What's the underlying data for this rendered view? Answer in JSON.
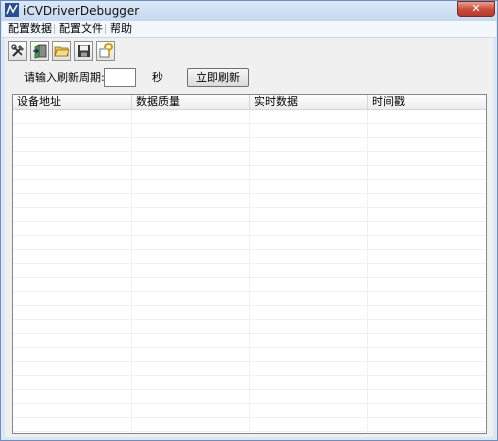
{
  "window": {
    "title": "iCVDriverDebugger",
    "close_symbol": "✕"
  },
  "menu": [
    {
      "label": "配置数据"
    },
    {
      "label": "配置文件"
    },
    {
      "label": "帮助"
    }
  ],
  "toolbar": {
    "buttons": [
      {
        "icon": "tools-icon"
      },
      {
        "icon": "open-door-icon"
      },
      {
        "icon": "folder-icon"
      },
      {
        "icon": "save-icon"
      },
      {
        "icon": "help-icon"
      }
    ]
  },
  "refresh": {
    "period_label": "请输入刷新周期:",
    "period_value": "",
    "unit_label": "秒",
    "button_label": "立即刷新"
  },
  "table": {
    "columns": [
      "设备地址",
      "数据质量",
      "实时数据",
      "时间戳"
    ],
    "rows": []
  },
  "colors": {
    "close_button": "#c9493a",
    "grid_line": "#f0f0f0"
  }
}
